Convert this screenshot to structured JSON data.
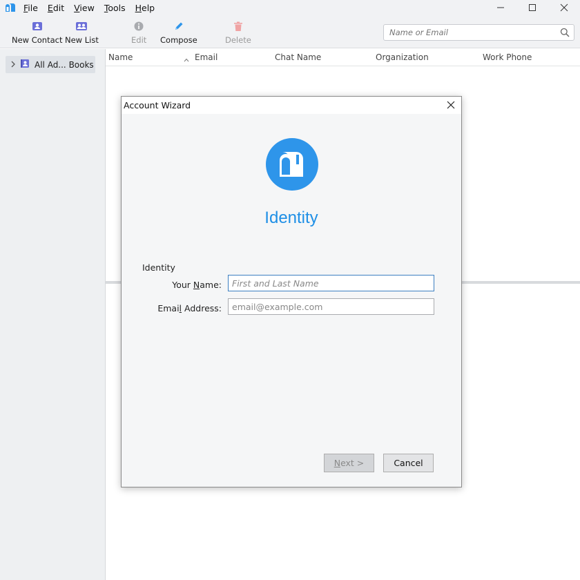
{
  "menubar": {
    "items": [
      {
        "label": "File",
        "accel": "F",
        "rest": "ile"
      },
      {
        "label": "Edit",
        "accel": "E",
        "rest": "dit"
      },
      {
        "label": "View",
        "accel": "V",
        "rest": "iew"
      },
      {
        "label": "Tools",
        "accel": "T",
        "rest": "ools"
      },
      {
        "label": "Help",
        "accel": "H",
        "rest": "elp"
      }
    ]
  },
  "toolbar": {
    "new_contact": "New Contact",
    "new_list": "New List",
    "edit": "Edit",
    "compose": "Compose",
    "delete": "Delete",
    "search_placeholder": "Name or Email"
  },
  "sidebar": {
    "items": [
      {
        "label": "All Ad... Books"
      }
    ]
  },
  "columns": [
    "Name",
    "Email",
    "Chat Name",
    "Organization",
    "Work Phone"
  ],
  "dialog": {
    "title": "Account Wizard",
    "heading": "Identity",
    "section": "Identity",
    "name_label_pre": "Your ",
    "name_label_accel": "N",
    "name_label_post": "ame:",
    "name_placeholder": "First and Last Name",
    "email_label_pre": "Emai",
    "email_label_accel": "l",
    "email_label_post": " Address:",
    "email_placeholder": "email@example.com",
    "next_accel": "N",
    "next_rest": "ext >",
    "cancel": "Cancel"
  },
  "colors": {
    "accent": "#1e8fe6",
    "logo_bg": "#2e95ea",
    "toolbar_icon": "#6b6fd8",
    "delete_icon": "#f0a3a3"
  }
}
